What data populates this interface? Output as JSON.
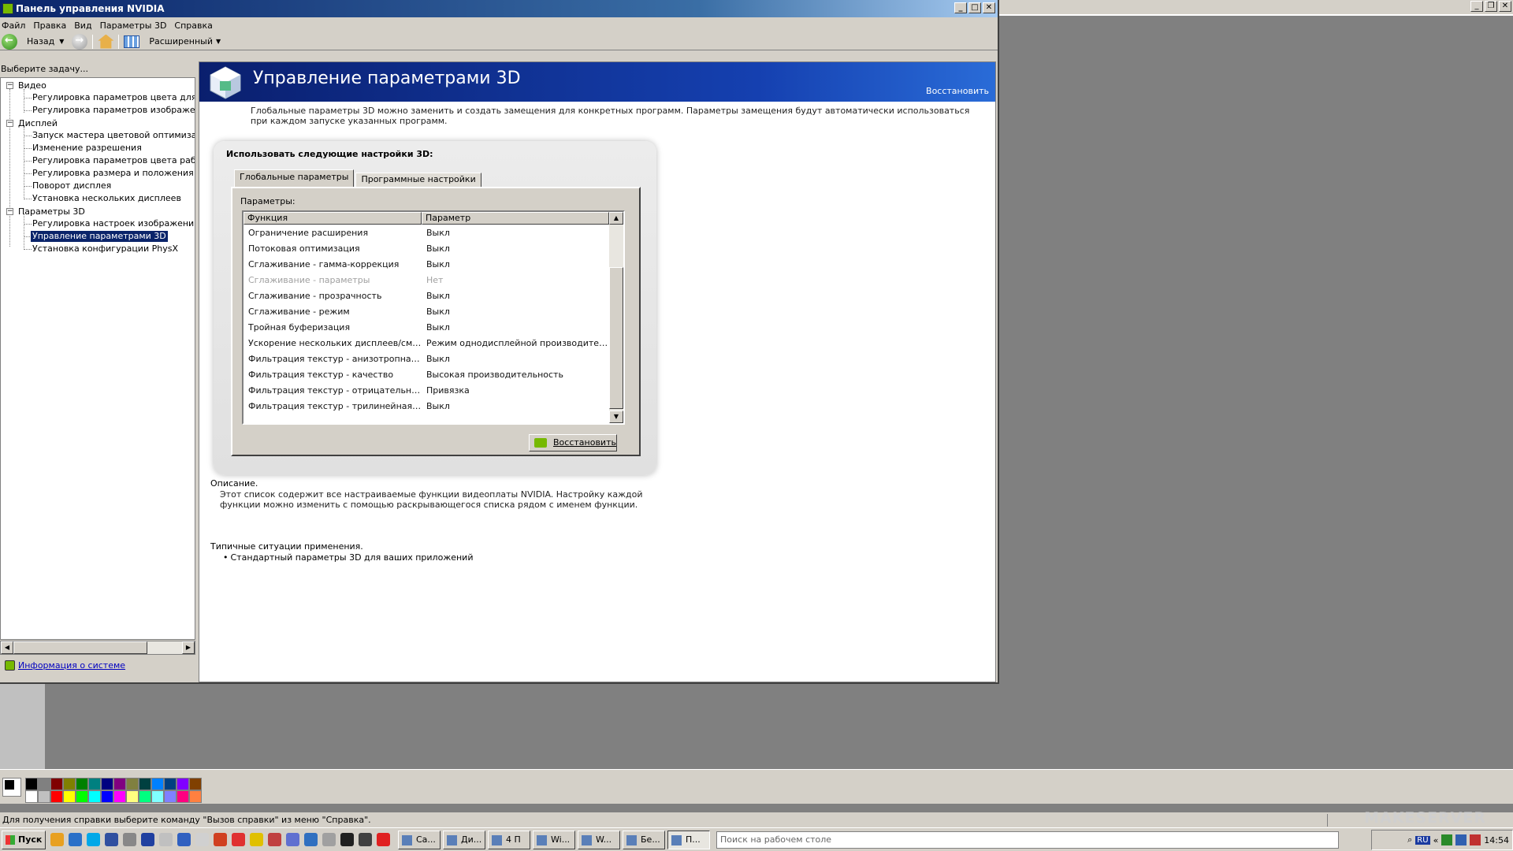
{
  "window": {
    "title": "Панель управления NVIDIA"
  },
  "menu": [
    "Файл",
    "Правка",
    "Вид",
    "Параметры 3D",
    "Справка"
  ],
  "toolbar": {
    "back_label": "Назад",
    "view_label": "Расширенный"
  },
  "sidebar": {
    "prompt": "Выберите задачу...",
    "groups": [
      {
        "label": "Видео",
        "items": [
          "Регулировка параметров цвета для вид",
          "Регулировка параметров изображения д"
        ]
      },
      {
        "label": "Дисплей",
        "items": [
          "Запуск мастера цветовой оптимизации",
          "Изменение разрешения",
          "Регулировка параметров цвета рабочег",
          "Регулировка размера и положения рабо",
          "Поворот дисплея",
          "Установка нескольких дисплеев"
        ]
      },
      {
        "label": "Параметры 3D",
        "items": [
          "Регулировка настроек изображения с пр",
          "Управление параметрами 3D",
          "Установка конфигурации PhysX"
        ]
      }
    ],
    "system_info": "Информация о системе"
  },
  "page": {
    "title": "Управление параметрами 3D",
    "restore_link": "Восстановить",
    "intro": "Глобальные параметры 3D можно заменить и создать замещения для конкретных программ. Параметры замещения будут автоматически использоваться при каждом запуске указанных программ.",
    "box_heading": "Использовать следующие настройки 3D:",
    "tabs": [
      "Глобальные параметры",
      "Программные настройки"
    ],
    "params_label": "Параметры:",
    "columns": [
      "Функция",
      "Параметр"
    ],
    "rows": [
      {
        "f": "Ограничение расширения",
        "v": "Выкл"
      },
      {
        "f": "Потоковая оптимизация",
        "v": "Выкл"
      },
      {
        "f": "Сглаживание - гамма-коррекция",
        "v": "Выкл"
      },
      {
        "f": "Сглаживание - параметры",
        "v": "Нет"
      },
      {
        "f": "Сглаживание - прозрачность",
        "v": "Выкл"
      },
      {
        "f": "Сглаживание - режим",
        "v": "Выкл"
      },
      {
        "f": "Тройная буферизация",
        "v": "Выкл"
      },
      {
        "f": "Ускорение нескольких дисплеев/смеша...",
        "v": "Режим однодисплейной производитель..."
      },
      {
        "f": "Фильтрация текстур - анизотропная оп...",
        "v": "Выкл"
      },
      {
        "f": "Фильтрация текстур - качество",
        "v": "Высокая производительность"
      },
      {
        "f": "Фильтрация текстур - отрицательное о...",
        "v": "Привязка"
      },
      {
        "f": "Фильтрация текстур - трилинейная опт...",
        "v": "Выкл"
      }
    ],
    "restore_button": "Восстановить",
    "description_label": "Описание.",
    "description": "Этот список содержит все настраиваемые функции видеоплаты NVIDIA. Настройку каждой функции можно изменить с помощью раскрывающегося списка рядом с именем функции.",
    "usage_label": "Типичные ситуации применения.",
    "usage_item": "Стандартный параметры 3D для ваших приложений"
  },
  "statusbar": {
    "text": "Для получения справки выберите команду \"Вызов справки\" из меню \"Справка\"."
  },
  "taskbar": {
    "start": "Пуск",
    "tasks": [
      "Са...",
      "Ди...",
      "4 П",
      "Wi...",
      "W...",
      "Бе...",
      "П..."
    ],
    "search_placeholder": "Поиск на рабочем столе",
    "lang": "RU",
    "clock": "14:54"
  },
  "watermark": "MAKESERVER",
  "palette": [
    "#000000",
    "#808080",
    "#800000",
    "#808000",
    "#008000",
    "#008080",
    "#000080",
    "#800080",
    "#808040",
    "#004040",
    "#0080ff",
    "#004080",
    "#8000ff",
    "#804000",
    "#ffffff",
    "#c0c0c0",
    "#ff0000",
    "#ffff00",
    "#00ff00",
    "#00ffff",
    "#0000ff",
    "#ff00ff",
    "#ffff80",
    "#00ff80",
    "#80ffff",
    "#8080ff",
    "#ff0080",
    "#ff8040"
  ]
}
